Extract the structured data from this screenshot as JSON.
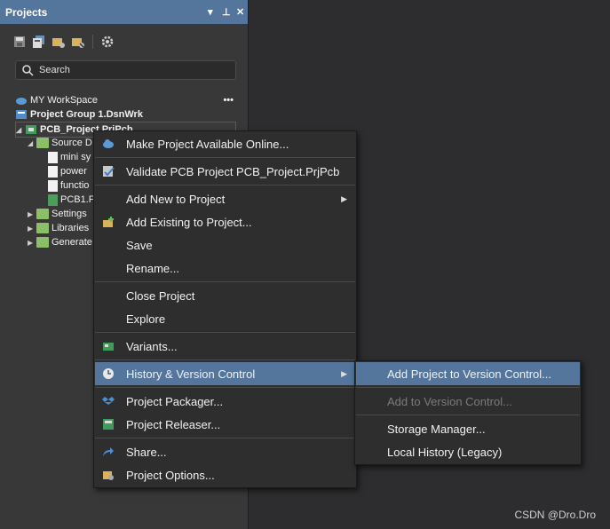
{
  "panel": {
    "title": "Projects",
    "controls": [
      "▾",
      "⊥",
      "✕"
    ],
    "search_placeholder": "Search",
    "toolbar_icons": [
      "save-icon",
      "save-all-icon",
      "open-folder-icon",
      "close-folder-icon",
      "settings-icon"
    ]
  },
  "tree": {
    "workspace": "MY WorkSpace",
    "workspace_more": "•••",
    "group": "Project Group 1.DsnWrk",
    "project": "PCB_Project.PrjPcb",
    "source_folder": "Source D",
    "files": [
      "mini sy",
      "power",
      "functio",
      "PCB1.P"
    ],
    "settings": "Settings",
    "libraries": "Libraries",
    "generated": "Generate"
  },
  "context_menu": {
    "items": [
      {
        "label": "Make Project Available Online...",
        "icon": "cloud-icon"
      },
      {
        "label": "Validate PCB Project PCB_Project.PrjPcb",
        "icon": "validate-icon"
      },
      {
        "label": "Add New to Project",
        "icon": ""
      },
      {
        "label": "Add Existing to Project...",
        "icon": "add-existing-icon"
      },
      {
        "label": "Save",
        "icon": ""
      },
      {
        "label": "Rename...",
        "icon": ""
      },
      {
        "label": "Close Project",
        "icon": ""
      },
      {
        "label": "Explore",
        "icon": ""
      },
      {
        "label": "Variants...",
        "icon": "variants-icon"
      },
      {
        "label": "History & Version Control",
        "icon": "clock-icon"
      },
      {
        "label": "Project Packager...",
        "icon": "dropbox-icon"
      },
      {
        "label": "Project Releaser...",
        "icon": "releaser-icon"
      },
      {
        "label": "Share...",
        "icon": "share-icon"
      },
      {
        "label": "Project Options...",
        "icon": "options-icon"
      }
    ]
  },
  "submenu": {
    "items": [
      {
        "label": "Add Project to Version Control..."
      },
      {
        "label": "Add to Version Control..."
      },
      {
        "label": "Storage Manager..."
      },
      {
        "label": "Local History (Legacy)"
      }
    ]
  },
  "watermark": "CSDN @Dro.Dro",
  "colors": {
    "accent": "#54759c",
    "menu_bg": "#2e2e2e",
    "panel_bg": "#383838"
  }
}
